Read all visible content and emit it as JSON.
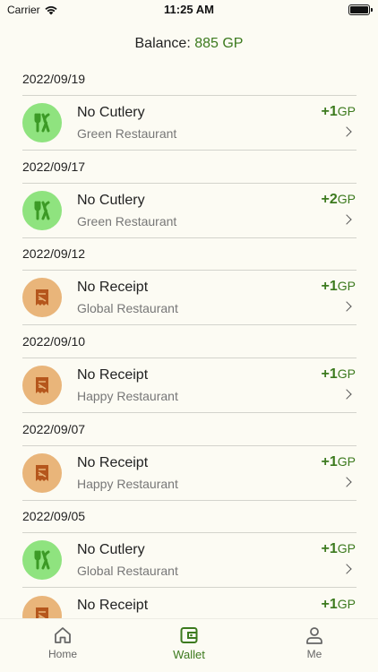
{
  "status_bar": {
    "carrier": "Carrier",
    "time": "11:25 AM"
  },
  "balance": {
    "label": "Balance:",
    "value": "885 GP"
  },
  "entries": [
    {
      "date": "2022/09/19",
      "title": "No Cutlery",
      "restaurant": "Green Restaurant",
      "points": "+1",
      "unit": "GP",
      "icon": "cutlery-icon",
      "color": "#8fe37f"
    },
    {
      "date": "2022/09/17",
      "title": "No Cutlery",
      "restaurant": "Green Restaurant",
      "points": "+2",
      "unit": "GP",
      "icon": "cutlery-icon",
      "color": "#8fe37f"
    },
    {
      "date": "2022/09/12",
      "title": "No Receipt",
      "restaurant": "Global Restaurant",
      "points": "+1",
      "unit": "GP",
      "icon": "receipt-icon",
      "color": "#e9b57a"
    },
    {
      "date": "2022/09/10",
      "title": "No Receipt",
      "restaurant": "Happy Restaurant",
      "points": "+1",
      "unit": "GP",
      "icon": "receipt-icon",
      "color": "#e9b57a"
    },
    {
      "date": "2022/09/07",
      "title": "No Receipt",
      "restaurant": "Happy Restaurant",
      "points": "+1",
      "unit": "GP",
      "icon": "receipt-icon",
      "color": "#e9b57a"
    },
    {
      "date": "2022/09/05",
      "title": "No Cutlery",
      "restaurant": "Global Restaurant",
      "points": "+1",
      "unit": "GP",
      "icon": "cutlery-icon",
      "color": "#8fe37f"
    },
    {
      "date": "",
      "title": "No Receipt",
      "restaurant": "",
      "points": "+1",
      "unit": "GP",
      "icon": "receipt-icon",
      "color": "#e9b57a"
    }
  ],
  "tabs": [
    {
      "label": "Home",
      "icon": "home-icon",
      "active": false
    },
    {
      "label": "Wallet",
      "icon": "wallet-icon",
      "active": true
    },
    {
      "label": "Me",
      "icon": "person-icon",
      "active": false
    }
  ],
  "colors": {
    "accent": "#3c7a1e",
    "background": "#fcfbf3",
    "cutlery_badge": "#8fe37f",
    "receipt_badge": "#e9b57a",
    "cutlery_glyph": "#3c9a26",
    "receipt_glyph": "#b5561c"
  }
}
